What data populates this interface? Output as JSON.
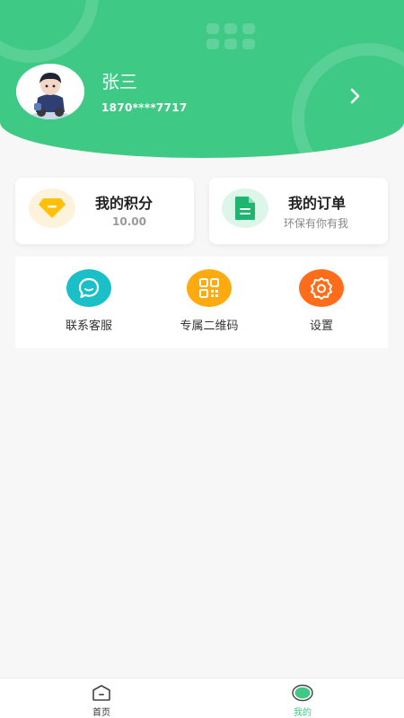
{
  "profile": {
    "name": "张三",
    "phone": "1870****7717",
    "avatar_icon": "avatar-image"
  },
  "cards": {
    "points": {
      "title": "我的积分",
      "value": "10.00",
      "icon": "diamond-icon"
    },
    "orders": {
      "title": "我的订单",
      "subtitle": "环保有你有我",
      "icon": "document-icon"
    }
  },
  "menu": {
    "items": [
      {
        "label": "联系客服",
        "icon": "chat-icon",
        "color": "#1bbfc8"
      },
      {
        "label": "专属二维码",
        "icon": "qrcode-icon",
        "color": "#ffab0f"
      },
      {
        "label": "设置",
        "icon": "gear-icon",
        "color": "#ff6d1b"
      }
    ]
  },
  "tabbar": {
    "home_label": "首页",
    "mine_label": "我的",
    "active_color": "#3ec985"
  },
  "theme": {
    "primary": "#3ec985",
    "background": "#f7f7f7"
  }
}
